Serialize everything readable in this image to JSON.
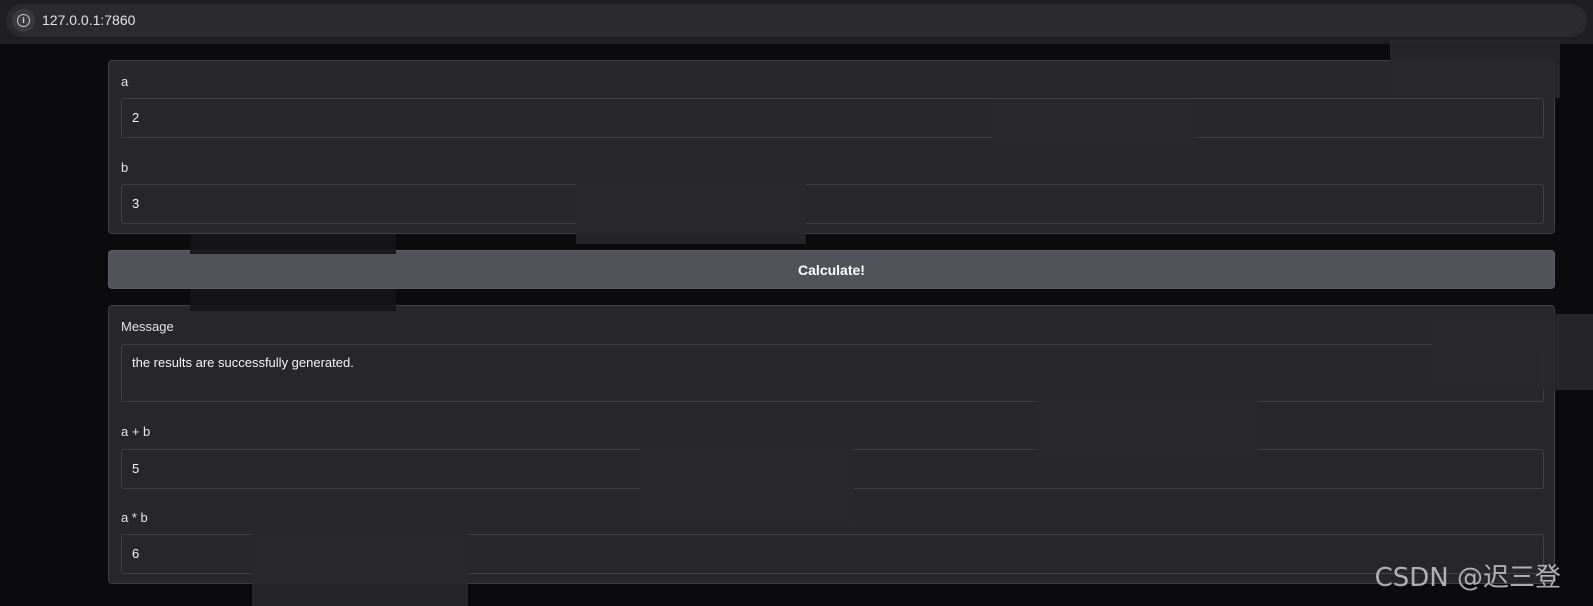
{
  "browser": {
    "url": "127.0.0.1:7860",
    "site_info_icon": "info-icon"
  },
  "inputs": {
    "a": {
      "label": "a",
      "value": "2"
    },
    "b": {
      "label": "b",
      "value": "3"
    }
  },
  "button": {
    "label": "Calculate!"
  },
  "outputs": {
    "message": {
      "label": "Message",
      "value": "the results are successfully generated."
    },
    "sum": {
      "label": "a + b",
      "value": "5"
    },
    "product": {
      "label": "a * b",
      "value": "6"
    }
  },
  "watermark": {
    "text": "CSDN @迟三登"
  },
  "colors": {
    "background": "#0b0b0d",
    "panel": "#27272a",
    "border": "#3f3f46",
    "button": "#52525b"
  }
}
